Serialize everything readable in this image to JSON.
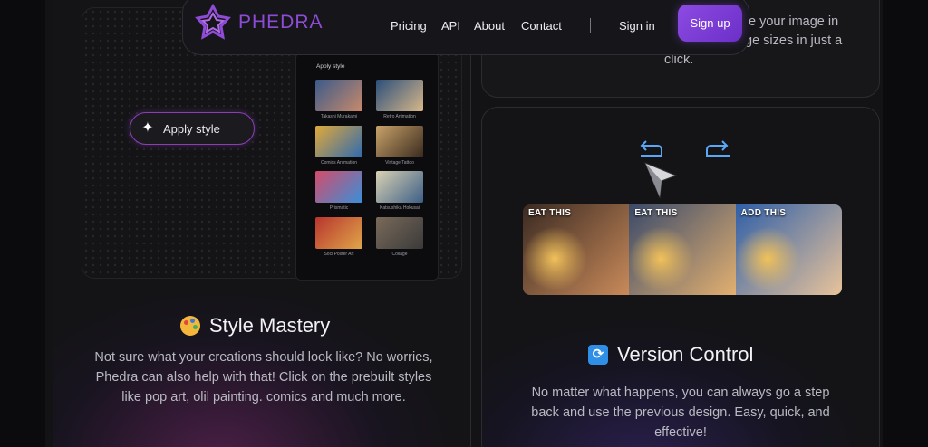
{
  "navbar": {
    "brand": "PHEDRA",
    "links": [
      "Pricing",
      "API",
      "About",
      "Contact"
    ],
    "signin_label": "Sign in",
    "signup_label": "Sign up",
    "accent_color": "#8d4be2"
  },
  "top_right_card": {
    "text_line1": "te your image in",
    "text_line2": "ge sizes in just a",
    "text_line3": "click."
  },
  "style_mastery": {
    "apply_button_label": "Apply style",
    "panel_title": "Apply style",
    "styles": [
      {
        "label": "Takashi Murakami",
        "colors": [
          "#3b5a8a",
          "#c98a6b"
        ]
      },
      {
        "label": "Retro Animation",
        "colors": [
          "#2b4e7a",
          "#d8b88a"
        ]
      },
      {
        "label": "Comics Animation",
        "colors": [
          "#e1a93a",
          "#2f6ab0"
        ]
      },
      {
        "label": "Vintage Tattoo",
        "colors": [
          "#c9a36a",
          "#3a2a1e"
        ]
      },
      {
        "label": "Prismatic",
        "colors": [
          "#d44c6b",
          "#3a8fd8"
        ]
      },
      {
        "label": "Katsushika Hokusai",
        "colors": [
          "#d9d1b4",
          "#3d5f86"
        ]
      },
      {
        "label": "Soci Poster Art",
        "colors": [
          "#b8352e",
          "#e0a64a"
        ]
      },
      {
        "label": "Collage",
        "colors": [
          "#7a6a5a",
          "#3a3a3a"
        ]
      }
    ],
    "title": "Style Mastery",
    "icon": "palette-icon",
    "description": "Not sure what your creations should look like? No worries, Phedra can also help with that! Click on the prebuilt styles like pop art, olil painting. comics and much more."
  },
  "version_control": {
    "undo_icon": "undo-arrow-icon",
    "redo_icon": "redo-arrow-icon",
    "slides": [
      {
        "tag": "EAT THIS",
        "colors": [
          "#3a2a22",
          "#c98a5a"
        ]
      },
      {
        "tag": "EAT THIS",
        "colors": [
          "#3a4a6a",
          "#e3b070"
        ]
      },
      {
        "tag": "ADD THIS",
        "colors": [
          "#2f5fa8",
          "#e8c39a"
        ]
      }
    ],
    "title": "Version Control",
    "icon": "sync-icon",
    "description": "No matter what happens, you can always go a step back and use the previous design. Easy, quick, and effective!"
  }
}
